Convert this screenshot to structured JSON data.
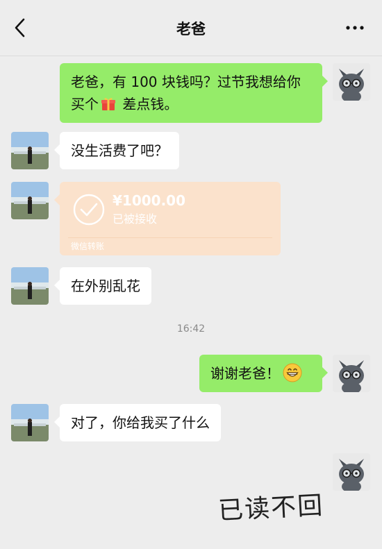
{
  "header": {
    "title": "老爸"
  },
  "messages": {
    "m1": {
      "text_before_gift": "老爸，有 100 块钱吗？过节我想给你买个",
      "text_after_gift": " 差点钱。"
    },
    "m2": {
      "text": "没生活费了吧？"
    },
    "transfer": {
      "amount": "¥1000.00",
      "status": "已被接收",
      "source": "微信转账"
    },
    "m4": {
      "text": "在外别乱花"
    },
    "timestamp": "16:42",
    "m5": {
      "text": "谢谢老爸！"
    },
    "m6": {
      "text": "对了，你给我买了什么"
    }
  },
  "handwriting": "已读不回",
  "colors": {
    "background": "#ededed",
    "sent_bubble": "#95ec69",
    "received_bubble": "#ffffff",
    "transfer_card": "#fbe2cc"
  },
  "icons": {
    "back": "chevron-left",
    "more": "ellipsis",
    "gift": "gift-emoji",
    "grin": "grinning-emoji",
    "received": "check-circle"
  }
}
